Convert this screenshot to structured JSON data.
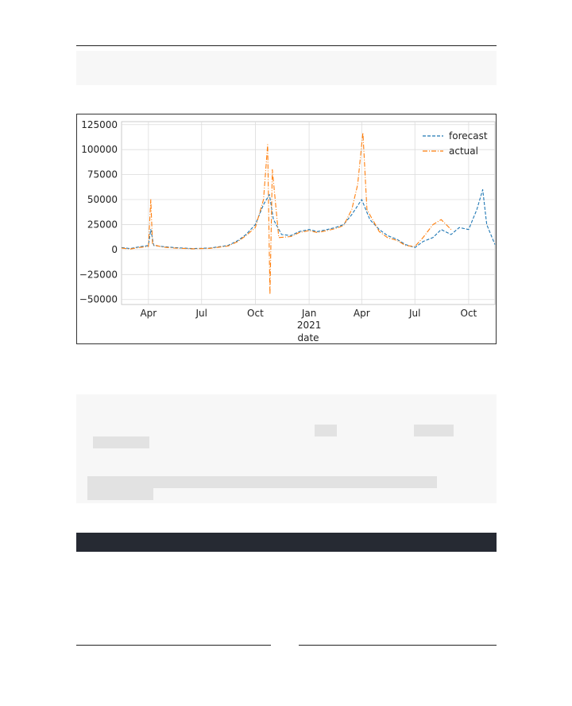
{
  "chart_data": {
    "type": "line",
    "title": "",
    "xlabel": "date",
    "ylabel": "",
    "ylim": [
      -55000,
      128000
    ],
    "xlim": [
      "2020-02-15",
      "2021-11-15"
    ],
    "y_ticks": [
      125000,
      100000,
      75000,
      50000,
      25000,
      0,
      -25000,
      -50000
    ],
    "y_tick_labels": [
      "125000",
      "100000",
      "75000",
      "50000",
      "25000",
      "0",
      "−25000",
      "−50000"
    ],
    "x_ticks": [
      {
        "date": "2020-04-01",
        "label": "Apr"
      },
      {
        "date": "2020-07-01",
        "label": "Jul"
      },
      {
        "date": "2020-10-01",
        "label": "Oct"
      },
      {
        "date": "2021-01-01",
        "label": "Jan",
        "sublabel": "2021"
      },
      {
        "date": "2021-04-01",
        "label": "Apr"
      },
      {
        "date": "2021-07-01",
        "label": "Jul"
      },
      {
        "date": "2021-10-01",
        "label": "Oct"
      }
    ],
    "grid": true,
    "legend_position": "top-right",
    "series": [
      {
        "name": "forecast",
        "color": "#1f77b4",
        "dash": "4,2",
        "points": [
          [
            "2020-02-15",
            2000
          ],
          [
            "2020-03-01",
            1000
          ],
          [
            "2020-03-15",
            2500
          ],
          [
            "2020-04-01",
            4000
          ],
          [
            "2020-04-05",
            20000
          ],
          [
            "2020-04-10",
            4000
          ],
          [
            "2020-04-25",
            3000
          ],
          [
            "2020-05-15",
            2000
          ],
          [
            "2020-06-15",
            1000
          ],
          [
            "2020-07-15",
            1500
          ],
          [
            "2020-08-15",
            4000
          ],
          [
            "2020-09-01",
            9000
          ],
          [
            "2020-09-15",
            15000
          ],
          [
            "2020-10-01",
            25000
          ],
          [
            "2020-10-15",
            45000
          ],
          [
            "2020-10-25",
            55000
          ],
          [
            "2020-11-01",
            30000
          ],
          [
            "2020-11-15",
            15000
          ],
          [
            "2020-12-01",
            14000
          ],
          [
            "2020-12-15",
            18000
          ],
          [
            "2021-01-01",
            20000
          ],
          [
            "2021-01-15",
            18000
          ],
          [
            "2021-02-01",
            20000
          ],
          [
            "2021-02-15",
            22000
          ],
          [
            "2021-03-01",
            25000
          ],
          [
            "2021-03-15",
            35000
          ],
          [
            "2021-04-01",
            50000
          ],
          [
            "2021-04-15",
            30000
          ],
          [
            "2021-05-01",
            20000
          ],
          [
            "2021-05-15",
            14000
          ],
          [
            "2021-06-01",
            10000
          ],
          [
            "2021-06-15",
            5000
          ],
          [
            "2021-07-01",
            2000
          ],
          [
            "2021-07-15",
            8000
          ],
          [
            "2021-08-01",
            12000
          ],
          [
            "2021-08-15",
            20000
          ],
          [
            "2021-09-01",
            15000
          ],
          [
            "2021-09-15",
            22000
          ],
          [
            "2021-10-01",
            20000
          ],
          [
            "2021-10-15",
            40000
          ],
          [
            "2021-10-25",
            60000
          ],
          [
            "2021-11-01",
            25000
          ],
          [
            "2021-11-15",
            5000
          ]
        ]
      },
      {
        "name": "actual",
        "color": "#ff7f0e",
        "dash": "6,2,1,2",
        "points": [
          [
            "2020-02-15",
            1500
          ],
          [
            "2020-03-01",
            500
          ],
          [
            "2020-03-15",
            2000
          ],
          [
            "2020-04-01",
            3000
          ],
          [
            "2020-04-05",
            50000
          ],
          [
            "2020-04-08",
            5000
          ],
          [
            "2020-04-25",
            2500
          ],
          [
            "2020-05-15",
            1500
          ],
          [
            "2020-06-15",
            800
          ],
          [
            "2020-07-15",
            1200
          ],
          [
            "2020-08-15",
            3500
          ],
          [
            "2020-09-01",
            8000
          ],
          [
            "2020-09-15",
            14000
          ],
          [
            "2020-10-01",
            22000
          ],
          [
            "2020-10-15",
            50000
          ],
          [
            "2020-10-22",
            105000
          ],
          [
            "2020-10-26",
            -45000
          ],
          [
            "2020-10-30",
            80000
          ],
          [
            "2020-11-10",
            12000
          ],
          [
            "2020-12-01",
            13000
          ],
          [
            "2020-12-15",
            17000
          ],
          [
            "2021-01-01",
            19000
          ],
          [
            "2021-01-15",
            17000
          ],
          [
            "2021-02-01",
            19000
          ],
          [
            "2021-02-15",
            21000
          ],
          [
            "2021-03-01",
            24000
          ],
          [
            "2021-03-15",
            40000
          ],
          [
            "2021-03-25",
            65000
          ],
          [
            "2021-04-03",
            117000
          ],
          [
            "2021-04-10",
            40000
          ],
          [
            "2021-05-01",
            18000
          ],
          [
            "2021-05-15",
            12000
          ],
          [
            "2021-06-01",
            9000
          ],
          [
            "2021-06-15",
            4000
          ],
          [
            "2021-07-01",
            3000
          ],
          [
            "2021-07-15",
            12000
          ],
          [
            "2021-08-01",
            25000
          ],
          [
            "2021-08-15",
            30000
          ],
          [
            "2021-09-01",
            20000
          ]
        ]
      }
    ]
  }
}
